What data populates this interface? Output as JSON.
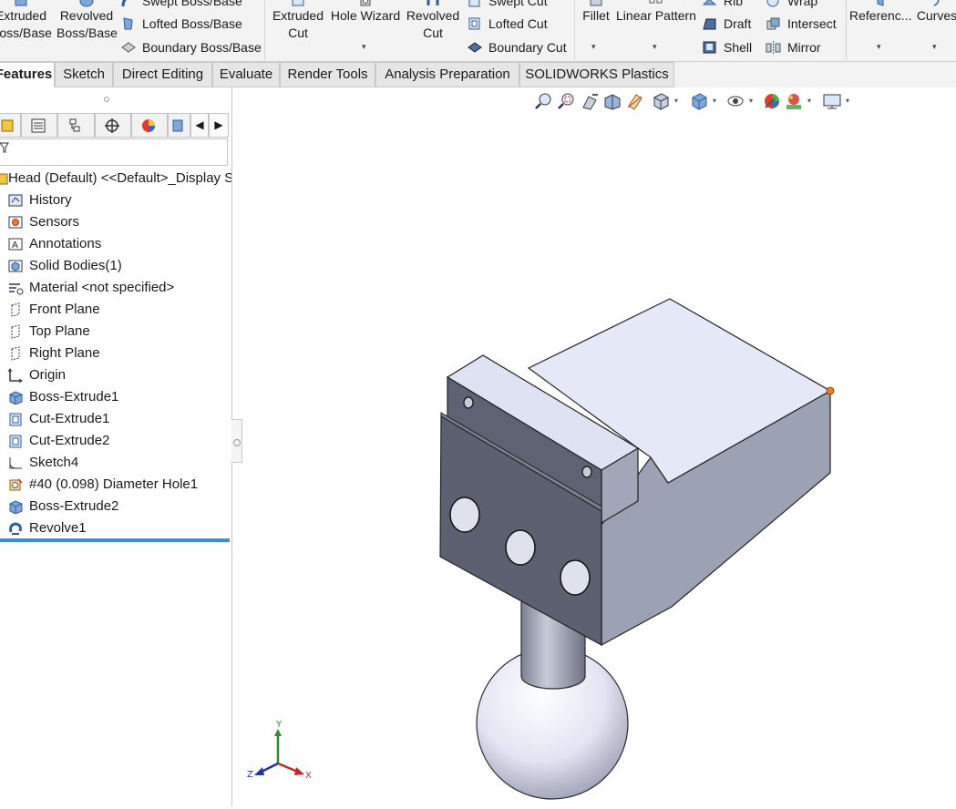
{
  "ribbon": {
    "extruded_boss_line1": "Extruded",
    "extruded_boss_line2": "Boss/Base",
    "revolved_boss_line1": "Revolved",
    "revolved_boss_line2": "Boss/Base",
    "swept_boss": "Swept Boss/Base",
    "lofted_boss": "Lofted Boss/Base",
    "boundary_boss": "Boundary Boss/Base",
    "extruded_cut_line1": "Extruded",
    "extruded_cut_line2": "Cut",
    "hole_wizard": "Hole Wizard",
    "revolved_cut_line1": "Revolved",
    "revolved_cut_line2": "Cut",
    "swept_cut": "Swept Cut",
    "lofted_cut": "Lofted Cut",
    "boundary_cut": "Boundary Cut",
    "fillet": "Fillet",
    "linear_pattern": "Linear Pattern",
    "rib": "Rib",
    "draft": "Draft",
    "shell": "Shell",
    "wrap": "Wrap",
    "intersect": "Intersect",
    "mirror": "Mirror",
    "reference": "Referenc...",
    "curves": "Curves"
  },
  "tabs": [
    {
      "label": "Features"
    },
    {
      "label": "Sketch"
    },
    {
      "label": "Direct Editing"
    },
    {
      "label": "Evaluate"
    },
    {
      "label": "Render Tools"
    },
    {
      "label": "Analysis Preparation"
    },
    {
      "label": "SOLIDWORKS Plastics"
    }
  ],
  "tree": {
    "root": "Head (Default) <<Default>_Display S",
    "items": [
      {
        "label": "History",
        "icon": "history-icon"
      },
      {
        "label": "Sensors",
        "icon": "sensors-icon"
      },
      {
        "label": "Annotations",
        "icon": "annotations-icon"
      },
      {
        "label": "Solid Bodies(1)",
        "icon": "solid-bodies-icon"
      },
      {
        "label": "Material <not specified>",
        "icon": "material-icon"
      },
      {
        "label": "Front Plane",
        "icon": "plane-icon"
      },
      {
        "label": "Top Plane",
        "icon": "plane-icon"
      },
      {
        "label": "Right Plane",
        "icon": "plane-icon"
      },
      {
        "label": "Origin",
        "icon": "origin-icon"
      },
      {
        "label": "Boss-Extrude1",
        "icon": "extrude-icon"
      },
      {
        "label": "Cut-Extrude1",
        "icon": "cut-extrude-icon"
      },
      {
        "label": "Cut-Extrude2",
        "icon": "cut-extrude-icon"
      },
      {
        "label": "Sketch4",
        "icon": "sketch-icon"
      },
      {
        "label": "#40 (0.098) Diameter Hole1",
        "icon": "hole-icon"
      },
      {
        "label": "Boss-Extrude2",
        "icon": "extrude-icon"
      },
      {
        "label": "Revolve1",
        "icon": "revolve-icon"
      }
    ]
  },
  "triad": {
    "x": "X",
    "y": "Y",
    "z": "Z"
  },
  "colors": {
    "accent": "#3a8fd3",
    "part_top": "#e5e8f7",
    "part_front": "#5d6070",
    "part_side": "#9ca0b3",
    "selection_point": "#f07f1a"
  }
}
